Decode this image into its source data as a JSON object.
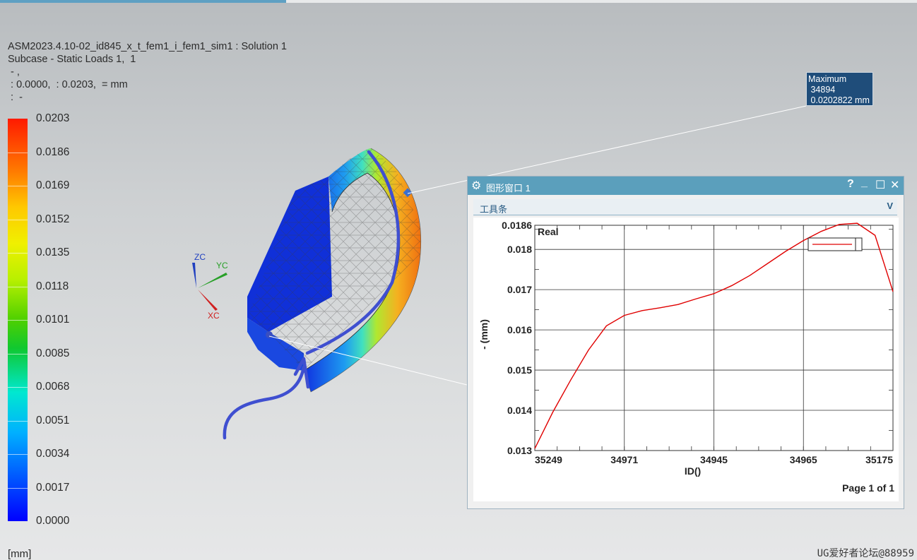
{
  "header": {
    "line1": "ASM2023.4.10-02_id845_x_t_fem1_i_fem1_sim1 : Solution 1",
    "line2": "Subcase - Static Loads 1,  1",
    "line3": " - ,",
    "line4": " : 0.0000,  : 0.0203,  = mm",
    "line5": " :  -"
  },
  "legend": {
    "labels": [
      "0.0203",
      "0.0186",
      "0.0169",
      "0.0152",
      "0.0135",
      "0.0118",
      "0.0101",
      "0.0085",
      "0.0068",
      "0.0051",
      "0.0034",
      "0.0017",
      "0.0000"
    ],
    "unit": "[mm]"
  },
  "triad": {
    "zc": "ZC",
    "yc": "YC",
    "xc": "XC"
  },
  "maximum_marker": {
    "line1": "Maximum",
    "line2": " 34894",
    "line3": " 0.0202822 mm"
  },
  "graph_window": {
    "title": "图形窗口 1",
    "help": "?",
    "minimize": "_",
    "maximize": "☐",
    "close": "✕",
    "toolbar_label": "工具条",
    "toolbar_chevron": "V",
    "page_label": "Page 1 of 1"
  },
  "chart_data": {
    "type": "line",
    "series": [
      {
        "name": "Real",
        "color": "#e00000",
        "x": [
          0,
          0.05,
          0.1,
          0.15,
          0.2,
          0.25,
          0.3,
          0.35,
          0.4,
          0.45,
          0.5,
          0.55,
          0.6,
          0.65,
          0.7,
          0.75,
          0.8,
          0.85,
          0.9,
          0.95,
          1.0
        ],
        "y": [
          0.01305,
          0.01395,
          0.01475,
          0.0155,
          0.0161,
          0.01636,
          0.01648,
          0.01655,
          0.01663,
          0.01677,
          0.0169,
          0.0171,
          0.01735,
          0.01765,
          0.01795,
          0.01822,
          0.01845,
          0.01862,
          0.01865,
          0.01835,
          0.01695
        ]
      }
    ],
    "x_tick_labels": [
      "35249",
      "34971",
      "34945",
      "34965",
      "35175"
    ],
    "xlabel": "ID()",
    "ylabel": "- (mm)",
    "y_tick_labels": [
      "0.0186",
      "0.018",
      "0.017",
      "0.016",
      "0.015",
      "0.014",
      "0.013"
    ],
    "y_tick_values": [
      0.0186,
      0.018,
      0.017,
      0.016,
      0.015,
      0.014,
      0.013
    ],
    "ylim": [
      0.013,
      0.0186
    ],
    "grid": true,
    "legend": "top-right"
  },
  "watermark": "UG爱好者论坛@88959"
}
